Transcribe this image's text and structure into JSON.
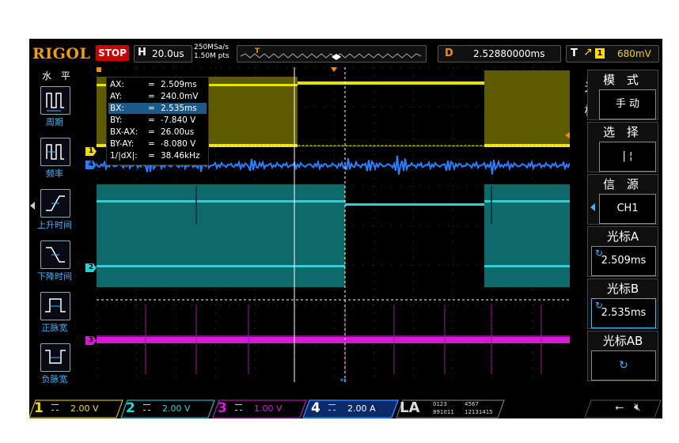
{
  "header": {
    "brand": "RIGOL",
    "run_status": "STOP",
    "timebase_key": "H",
    "timebase_value": "20.0us",
    "sample_rate": "250MSa/s",
    "memory_depth": "1.50M pts",
    "trig_pos_marker": "T",
    "delay_key": "D",
    "delay_value": "2.52880000ms",
    "trigger_key": "T",
    "trigger_source": "1",
    "trigger_level": "680mV"
  },
  "left_menu": {
    "title": "水 平",
    "items": [
      {
        "label": "周期",
        "icon": "period-icon"
      },
      {
        "label": "频率",
        "icon": "frequency-icon"
      },
      {
        "label": "上升时间",
        "icon": "rise-time-icon"
      },
      {
        "label": "下降时间",
        "icon": "fall-time-icon"
      },
      {
        "label": "正脉宽",
        "icon": "positive-width-icon"
      },
      {
        "label": "负脉宽",
        "icon": "negative-width-icon"
      }
    ]
  },
  "cursor_readout": {
    "rows": [
      {
        "name": "AX:",
        "eq": "=",
        "value": "2.509ms"
      },
      {
        "name": "AY:",
        "eq": "=",
        "value": "240.0mV"
      },
      {
        "name": "BX:",
        "eq": "=",
        "value": "2.535ms"
      },
      {
        "name": "BY:",
        "eq": "=",
        "value": "-7.840 V"
      },
      {
        "name": "BX-AX:",
        "eq": "=",
        "value": "26.00us"
      },
      {
        "name": "BY-AY:",
        "eq": "=",
        "value": "-8.080 V"
      },
      {
        "name": "1/|dX|:",
        "eq": "=",
        "value": "38.46kHz"
      }
    ]
  },
  "channel_markers": {
    "ch1": "1",
    "ch4": "4",
    "ch2": "2",
    "ch3": "3"
  },
  "right_menu": {
    "vertical_label": [
      "光",
      "标"
    ],
    "mode_title": "模 式",
    "mode_value": "手 动",
    "select_title": "选 择",
    "select_value": "| ¦",
    "source_title": "信 源",
    "source_value": "CH1",
    "cursor_a_title": "光标A",
    "cursor_a_value": "2.509ms",
    "cursor_b_title": "光标B",
    "cursor_b_value": "2.535ms",
    "cursor_ab_title": "光标AB"
  },
  "channels": [
    {
      "num": "1",
      "scale": "2.00 V",
      "color": "#f0e000"
    },
    {
      "num": "2",
      "scale": "2.00 V",
      "color": "#00d0d0"
    },
    {
      "num": "3",
      "scale": "1.00 V",
      "color": "#e020e0"
    },
    {
      "num": "4",
      "scale": "2.00 A",
      "color": "#2080ff"
    }
  ],
  "logic": {
    "label": "LA",
    "groups_top": [
      "0123",
      "4567"
    ],
    "groups_bottom": [
      "891011",
      "12131415"
    ]
  },
  "colors": {
    "ch1": "#f0e000",
    "ch2": "#00c8c8",
    "ch3": "#e020e0",
    "ch4": "#2a7fff",
    "accent": "#f09000",
    "selection": "#3ab8ff"
  }
}
